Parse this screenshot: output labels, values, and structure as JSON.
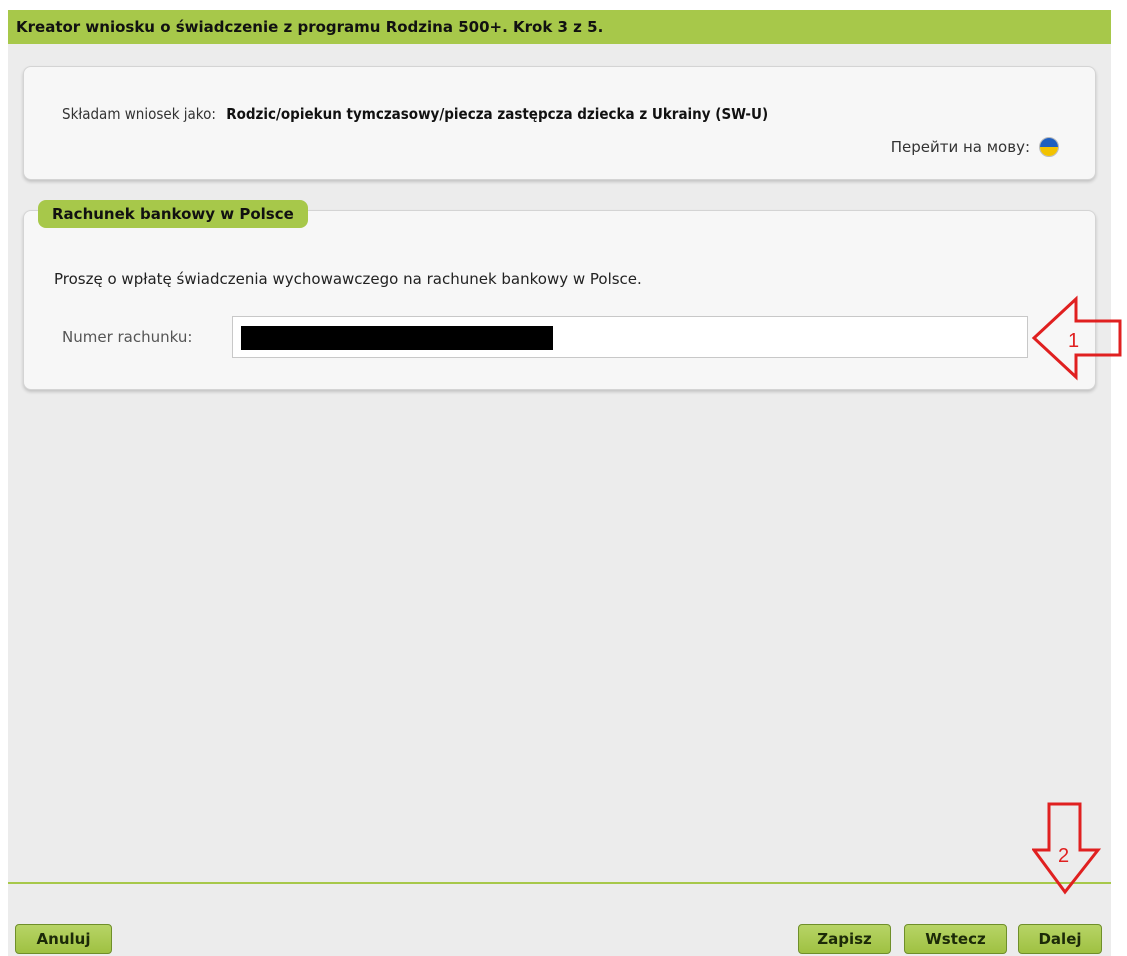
{
  "window": {
    "title": "Kreator wniosku o świadczenie z programu Rodzina 500+. Krok 3 z 5."
  },
  "applicant": {
    "label": "Składam wniosek jako:",
    "value": "Rodzic/opiekun tymczasowy/piecza zastępcza dziecka z Ukrainy (SW-U)",
    "language_link": "Перейти на мову:",
    "flag_icon": "ukraine-flag-icon"
  },
  "bank_section": {
    "legend": "Rachunek bankowy w Polsce",
    "description": "Proszę o wpłatę świadczenia wychowawczego na rachunek bankowy w Polsce.",
    "account_label": "Numer rachunku:",
    "account_value": ""
  },
  "buttons": {
    "cancel": "Anuluj",
    "save": "Zapisz",
    "back": "Wstecz",
    "next": "Dalej"
  },
  "annotations": {
    "arrow1_label": "1",
    "arrow2_label": "2",
    "color": "#e02020"
  },
  "colors": {
    "accent": "#a7c84a",
    "background": "#ececec"
  }
}
